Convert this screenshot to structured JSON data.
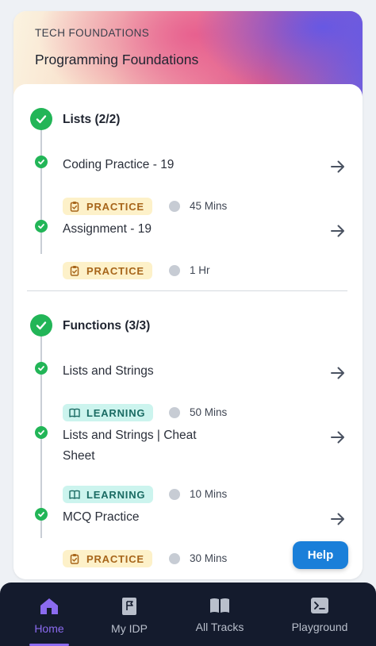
{
  "header": {
    "eyebrow": "TECH FOUNDATIONS",
    "title": "Programming Foundations"
  },
  "sections": [
    {
      "title": "Lists (2/2)",
      "items": [
        {
          "title": "Coding Practice - 19",
          "type": "PRACTICE",
          "duration": "45 Mins"
        },
        {
          "title": "Assignment - 19",
          "type": "PRACTICE",
          "duration": "1 Hr"
        }
      ]
    },
    {
      "title": "Functions (3/3)",
      "items": [
        {
          "title": "Lists and Strings",
          "type": "LEARNING",
          "duration": "50 Mins"
        },
        {
          "title_line1": "Lists and Strings | Cheat",
          "title_line2": "Sheet",
          "type": "LEARNING",
          "duration": "10 Mins"
        },
        {
          "title": "MCQ Practice",
          "type": "PRACTICE",
          "duration": "30 Mins"
        }
      ]
    }
  ],
  "help_label": "Help",
  "nav": [
    {
      "label": "Home",
      "icon": "home-icon",
      "active": true
    },
    {
      "label": "My IDP",
      "icon": "flag-doc-icon",
      "active": false
    },
    {
      "label": "All Tracks",
      "icon": "book-icon",
      "active": false
    },
    {
      "label": "Playground",
      "icon": "terminal-icon",
      "active": false
    }
  ],
  "colors": {
    "success": "#22b557",
    "practice_bg": "#fdf1c9",
    "practice_fg": "#a7651a",
    "learning_bg": "#ccf4ee",
    "learning_fg": "#1a6b63",
    "help": "#1a7fd9",
    "nav_bg": "#141b2d",
    "nav_active": "#8b6bf0"
  }
}
